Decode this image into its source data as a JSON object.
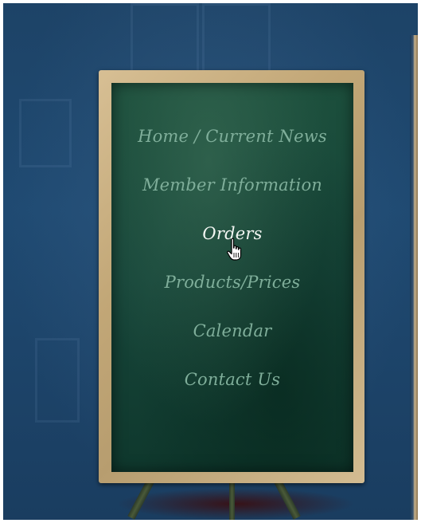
{
  "nav": {
    "items": [
      {
        "label": "Home / Current News",
        "active": false
      },
      {
        "label": "Member Information",
        "active": false
      },
      {
        "label": "Orders",
        "active": true
      },
      {
        "label": "Products/Prices",
        "active": false
      },
      {
        "label": "Calendar",
        "active": false
      },
      {
        "label": "Contact Us",
        "active": false
      }
    ]
  },
  "colors": {
    "background": "#1f4a72",
    "chalkboard": "#17463a",
    "frame": "#c2a777",
    "menu_text": "#7fae9a",
    "menu_text_active": "#f2f6f2"
  },
  "icons": {
    "cursor": "hand-pointer-icon"
  }
}
